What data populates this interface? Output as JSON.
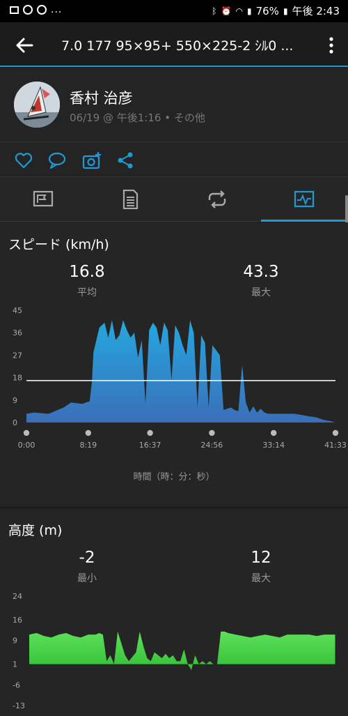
{
  "status_bar": {
    "time": "午後 2:43",
    "battery": "76%",
    "dots": "..."
  },
  "header": {
    "title": "7.0  177  95×95+  550×225-2 ｼﾙ0 ..."
  },
  "profile": {
    "name": "香村 治彦",
    "meta": "06/19 @ 午後1:16 • その他"
  },
  "speed": {
    "title": "スピード (km/h)",
    "avg_value": "16.8",
    "avg_label": "平均",
    "max_value": "43.3",
    "max_label": "最大",
    "x_axis_label": "時間（時：分：秒）",
    "chart_data": {
      "type": "area",
      "ylim": [
        0,
        45
      ],
      "y_ticks": [
        "45",
        "36",
        "27",
        "18",
        "9",
        "0"
      ],
      "x_ticks": [
        "0:00",
        "8:19",
        "16:37",
        "24:56",
        "33:14",
        "41:33"
      ],
      "average_line": 16.8,
      "color": "#2b8fd6",
      "series": [
        {
          "x": [
            0,
            1,
            3,
            5,
            6,
            7.5,
            8.5,
            8.8,
            9,
            9.8,
            10.5,
            11,
            11.5,
            12,
            12.5,
            13,
            13.5,
            14,
            14.5,
            15,
            15.5,
            16,
            16.5,
            17,
            17.5,
            18,
            18.5,
            19,
            19.5,
            20,
            20.5,
            21,
            21.5,
            22,
            22.5,
            23,
            23.5,
            24,
            24.5,
            25,
            25.5,
            26,
            26.5,
            27,
            27.5,
            28,
            28.5,
            29,
            29.5,
            30,
            30.5,
            31,
            31.5,
            32,
            32.5,
            33,
            33.5,
            34,
            35,
            36,
            37,
            38,
            39,
            40,
            41,
            41.5
          ],
          "y": [
            3.5,
            4,
            3.5,
            6,
            8,
            7.5,
            8.5,
            16,
            28,
            38,
            40,
            34,
            41,
            33,
            35,
            41,
            37,
            34,
            36,
            26,
            33,
            7.5,
            37,
            40,
            38,
            31,
            40,
            37,
            17,
            39,
            36,
            31,
            27,
            41,
            36,
            6,
            35,
            32,
            6,
            31,
            29,
            27,
            5,
            5.5,
            6,
            5,
            4.5,
            23,
            8,
            4,
            6.5,
            4,
            5.5,
            4,
            3.5,
            3.5,
            3.5,
            3.5,
            3.5,
            3.5,
            3,
            2.5,
            2,
            1,
            0.5,
            0
          ]
        }
      ]
    }
  },
  "altitude": {
    "title": "高度 (m)",
    "min_value": "-2",
    "min_label": "最小",
    "max_value": "12",
    "max_label": "最大",
    "chart_data": {
      "type": "area",
      "ylim": [
        -13,
        24
      ],
      "y_ticks": [
        "24",
        "16",
        "9",
        "1",
        "-6",
        "-13"
      ],
      "color": "#4fd34f",
      "series": [
        {
          "x": [
            0,
            1,
            2,
            3,
            4,
            5,
            6,
            7,
            8,
            9,
            9.5,
            10,
            10.5,
            11,
            11.5,
            12,
            12.5,
            13,
            13.5,
            14,
            14.5,
            15,
            15.5,
            16,
            16.5,
            17,
            17.5,
            18,
            18.5,
            19,
            19.5,
            20,
            20.5,
            21,
            21.5,
            22,
            22.5,
            23,
            23.5,
            24,
            24.5,
            25,
            25.5,
            26,
            26.5,
            27,
            28,
            29,
            30,
            31,
            32,
            33,
            34,
            35,
            36,
            37,
            38,
            39,
            40,
            41,
            41.5
          ],
          "y": [
            11,
            11.5,
            10.5,
            10,
            11,
            11.5,
            10.5,
            10,
            11,
            11,
            11.5,
            11,
            2,
            4,
            1,
            12,
            8,
            4,
            2,
            3.5,
            5,
            12,
            7,
            3,
            2,
            5,
            4,
            3,
            4.5,
            3,
            4,
            2,
            2,
            6,
            1,
            -1,
            4,
            1,
            2,
            1,
            2,
            1,
            1,
            12,
            12,
            11.5,
            11,
            10.5,
            10,
            10.5,
            11,
            10.5,
            10,
            11,
            11,
            11,
            11,
            10.5,
            11,
            11,
            11
          ]
        }
      ]
    }
  }
}
